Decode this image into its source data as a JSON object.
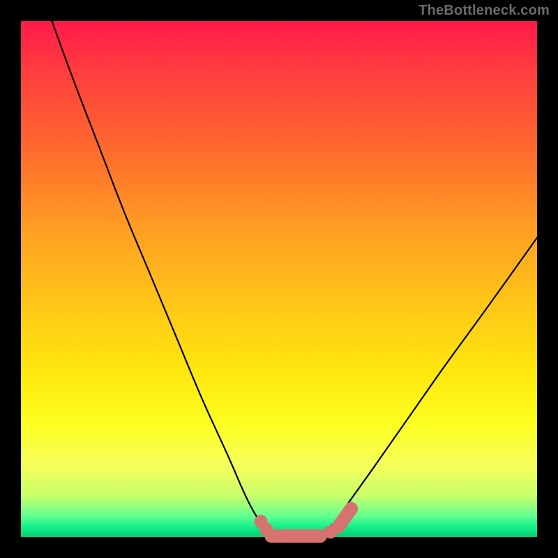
{
  "watermark": "TheBottleneck.com",
  "chart_data": {
    "type": "line",
    "title": "",
    "xlabel": "",
    "ylabel": "",
    "xlim": [
      0,
      100
    ],
    "ylim": [
      0,
      100
    ],
    "grid": false,
    "legend": false,
    "note": "Bottleneck curve: black V-shaped line over a red→green vertical gradient. Pink markers highlight the near-zero region at the trough.",
    "series": [
      {
        "name": "bottleneck-curve",
        "color": "#000000",
        "x": [
          6,
          10,
          15,
          20,
          25,
          30,
          35,
          40,
          44,
          47,
          49,
          51,
          54,
          57,
          60,
          63,
          68,
          75,
          82,
          90,
          100
        ],
        "values": [
          100,
          89,
          76,
          63,
          51,
          39,
          27,
          16,
          7,
          2,
          0,
          0,
          0,
          0,
          2,
          6,
          13,
          23,
          33,
          44,
          58
        ]
      }
    ],
    "markers": [
      {
        "shape": "circle",
        "x": 46.5,
        "y": 3.0,
        "r": 1.3
      },
      {
        "shape": "circle",
        "x": 47.5,
        "y": 1.5,
        "r": 1.3
      },
      {
        "shape": "pill",
        "x0": 48.5,
        "y0": 0.2,
        "x1": 58.0,
        "y1": 0.2,
        "r": 1.3
      },
      {
        "shape": "circle",
        "x": 60.0,
        "y": 1.0,
        "r": 1.3
      },
      {
        "shape": "pill",
        "x0": 61.5,
        "y0": 2.0,
        "x1": 64.0,
        "y1": 5.5,
        "r": 1.3
      }
    ],
    "background_gradient": {
      "direction": "vertical",
      "stops": [
        {
          "pos": 0.0,
          "color": "#ff1a49"
        },
        {
          "pos": 0.5,
          "color": "#ffbf1c"
        },
        {
          "pos": 0.8,
          "color": "#fbff2a"
        },
        {
          "pos": 0.95,
          "color": "#7dff7d"
        },
        {
          "pos": 1.0,
          "color": "#00d070"
        }
      ]
    }
  }
}
